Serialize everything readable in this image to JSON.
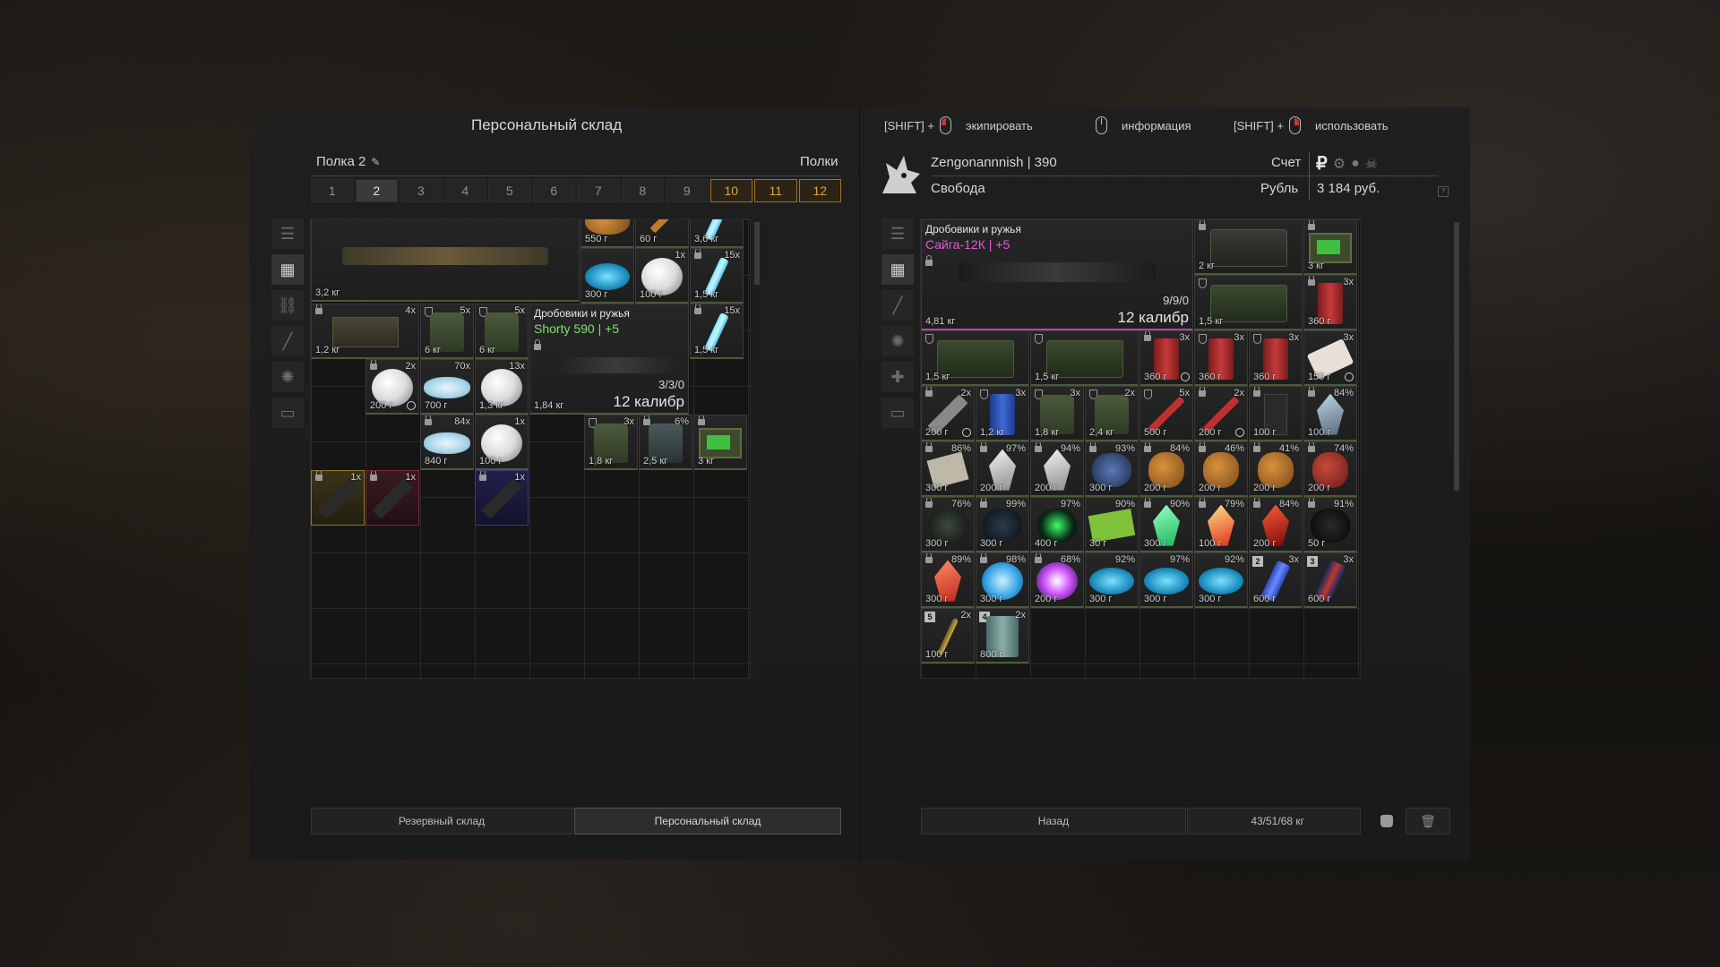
{
  "left_panel": {
    "title": "Персональный склад",
    "shelf_label": "Полка 2",
    "shelves_label": "Полки",
    "tabs": [
      "1",
      "2",
      "3",
      "4",
      "5",
      "6",
      "7",
      "8",
      "9",
      "10",
      "11",
      "12"
    ],
    "active_tab": "2",
    "bottom_buttons": [
      "Резервный склад",
      "Персональный склад"
    ],
    "items": [
      {
        "w": "3,2 кг"
      },
      {
        "w": "550 г"
      },
      {
        "w": "60 г"
      },
      {
        "w": "3,6 кг"
      },
      {
        "w": "300 г"
      },
      {
        "q": "1x",
        "w": "100 г"
      },
      {
        "q": "15x",
        "w": "1,5 кг"
      },
      {
        "q": "4x",
        "w": "1,2 кг"
      },
      {
        "q": "5x",
        "w": "6 кг"
      },
      {
        "q": "5x",
        "w": "6 кг"
      },
      {
        "q": "15x",
        "w": "1,5 кг"
      },
      {
        "q": "2x",
        "w": "200 г"
      },
      {
        "q": "70x",
        "w": "700 г"
      },
      {
        "q": "13x",
        "w": "1,3 кг"
      },
      {
        "q": "84x",
        "w": "840 г"
      },
      {
        "q": "1x",
        "w": "100 г"
      },
      {
        "q": "3x",
        "w": "1,8 кг"
      },
      {
        "q": "6%",
        "w": "2,5 кг"
      },
      {
        "w": "3 кг"
      },
      {
        "q": "1x"
      },
      {
        "q": "1x"
      },
      {
        "q": "1x"
      }
    ],
    "shotgun": {
      "category": "Дробовики и ружья",
      "name": "Shorty 590 | +5",
      "ammo": "3/3/0",
      "caliber": "12 калибр",
      "weight": "1,84 кг"
    }
  },
  "header_hints": {
    "equip_prefix": "[SHIFT] +",
    "equip": "экипировать",
    "info": "информация",
    "use_prefix": "[SHIFT] +",
    "use": "использовать"
  },
  "right_panel": {
    "player_name": "Zengonannnish | 390",
    "status": "Свобода",
    "account_label": "Счет",
    "currency_label": "Рубль",
    "balance": "3 184 руб.",
    "weapon": {
      "category": "Дробовики и ружья",
      "name": "Сайга-12К | +5",
      "ammo": "9/9/0",
      "caliber": "12 калибр",
      "weight": "4,81 кг"
    },
    "bottom": {
      "back": "Назад",
      "weight": "43/51/68 кг"
    },
    "items": [
      {
        "w": "2 кг"
      },
      {
        "w": "3 кг"
      },
      {
        "w": "1,5 кг"
      },
      {
        "q": "3x",
        "w": "360 г"
      },
      {
        "w": "1,5 кг"
      },
      {
        "w": "1,5 кг"
      },
      {
        "q": "3x",
        "w": "360 г"
      },
      {
        "q": "3x",
        "w": "360 г"
      },
      {
        "q": "3x",
        "w": "360 г"
      },
      {
        "q": "3x",
        "w": "150 г"
      },
      {
        "q": "2x",
        "w": "200 г"
      },
      {
        "q": "3x",
        "w": "1,2 кг"
      },
      {
        "q": "3x",
        "w": "1,8 кг"
      },
      {
        "q": "2x",
        "w": "2,4 кг"
      },
      {
        "q": "5x",
        "w": "500 г"
      },
      {
        "q": "2x",
        "w": "200 г"
      },
      {
        "w": "100 г"
      },
      {
        "q": "84%",
        "w": "100 г"
      },
      {
        "q": "86%",
        "w": "300 г"
      },
      {
        "q": "97%",
        "w": "200 г"
      },
      {
        "q": "94%",
        "w": "200 г"
      },
      {
        "q": "93%",
        "w": "300 г"
      },
      {
        "q": "84%",
        "w": "200 г"
      },
      {
        "q": "46%",
        "w": "200 г"
      },
      {
        "q": "41%",
        "w": "200 г"
      },
      {
        "q": "74%",
        "w": "200 г"
      },
      {
        "q": "76%",
        "w": "300 г"
      },
      {
        "q": "99%",
        "w": "300 г"
      },
      {
        "q": "97%",
        "w": "400 г"
      },
      {
        "q": "90%",
        "w": "30 г"
      },
      {
        "q": "90%",
        "w": "300 г"
      },
      {
        "q": "79%",
        "w": "100 г"
      },
      {
        "q": "84%",
        "w": "200 г"
      },
      {
        "q": "91%",
        "w": "50 г"
      },
      {
        "q": "89%",
        "w": "300 г"
      },
      {
        "q": "98%",
        "w": "300 г"
      },
      {
        "q": "68%",
        "w": "200 г"
      },
      {
        "q": "92%",
        "w": "300 г"
      },
      {
        "q": "97%",
        "w": "300 г"
      },
      {
        "q": "92%",
        "w": "300 г"
      },
      {
        "q": "3x",
        "w": "600 г"
      },
      {
        "q": "3x",
        "w": "600 г"
      },
      {
        "q": "2x",
        "w": "100 г"
      },
      {
        "q": "2x",
        "w": "800 г"
      }
    ],
    "slot_numbers": [
      "2",
      "3",
      "5",
      "4"
    ]
  },
  "colors": {
    "accent_gold": "#d8a43a",
    "weapon_pink": "#e05ad8",
    "shorty_green": "#7be36a"
  }
}
